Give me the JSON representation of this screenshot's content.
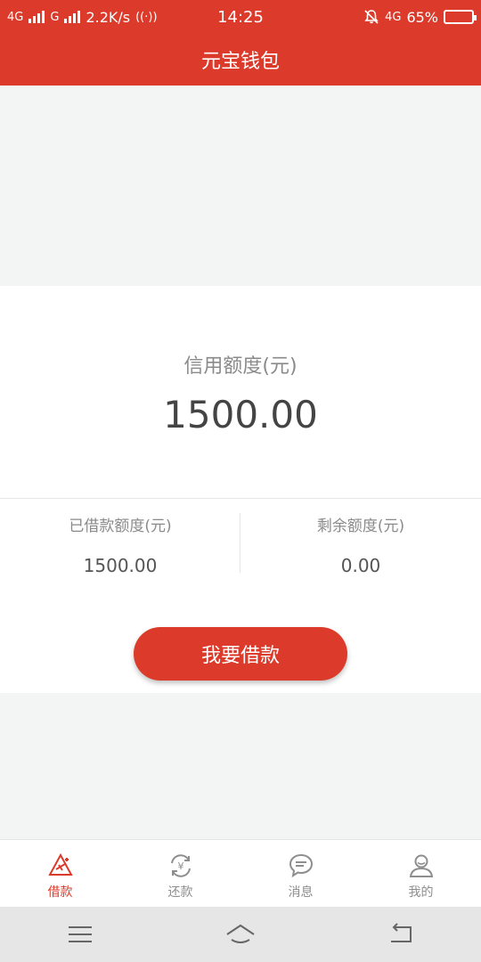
{
  "status_bar": {
    "network1": "4G",
    "network2": "G",
    "speed": "2.2K/s",
    "time": "14:25",
    "network3": "4G",
    "battery": "65%",
    "battery_level": 0.65
  },
  "header": {
    "title": "元宝钱包"
  },
  "credit": {
    "label": "信用额度(元)",
    "value": "1500.00"
  },
  "stats": {
    "borrowed_label": "已借款额度(元)",
    "borrowed_value": "1500.00",
    "remaining_label": "剩余额度(元)",
    "remaining_value": "0.00"
  },
  "actions": {
    "borrow_button": "我要借款"
  },
  "tabs": [
    {
      "label": "借款",
      "icon": "borrow-icon",
      "active": true
    },
    {
      "label": "还款",
      "icon": "repay-icon",
      "active": false
    },
    {
      "label": "消息",
      "icon": "message-icon",
      "active": false
    },
    {
      "label": "我的",
      "icon": "profile-icon",
      "active": false
    }
  ],
  "colors": {
    "brand": "#dc3a2a",
    "tab_inactive": "#8e8e8e"
  }
}
